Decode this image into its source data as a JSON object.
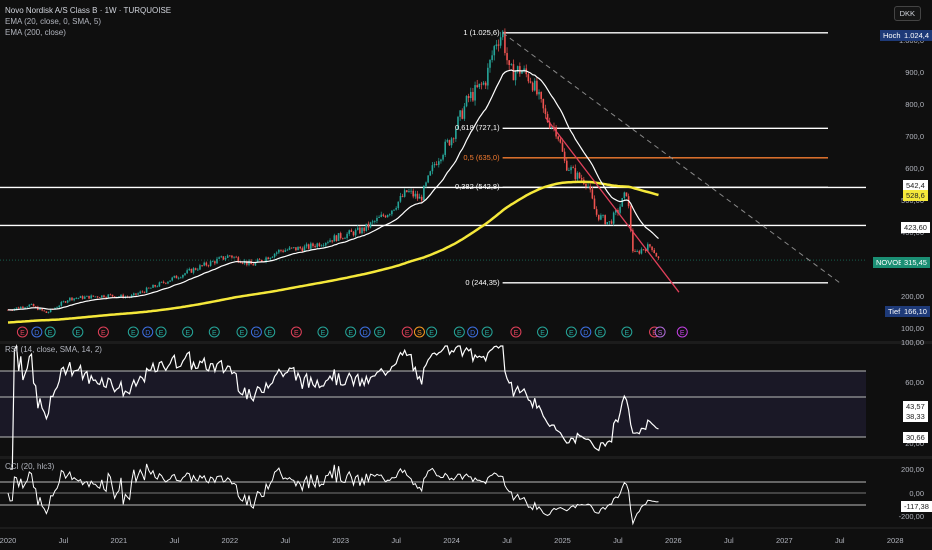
{
  "header": {
    "title": "Novo Nordisk A/S Class B · 1W · TURQUOISE",
    "indicator_1": "EMA (20, close, 0, SMA, 5)",
    "indicator_2": "EMA (200, close)",
    "currency": "DKK"
  },
  "price_axis": {
    "ticks": [
      "1.000,0",
      "900,0",
      "800,0",
      "700,0",
      "600,0",
      "500,00",
      "400,00",
      "200,00",
      "100,00"
    ],
    "tick_values": [
      1000,
      900,
      800,
      700,
      600,
      500,
      400,
      200,
      100
    ],
    "high_label": "Hoch",
    "high_value": "1.024,4",
    "low_label": "Tief",
    "low_value": "166,10",
    "symbol": "NOVOBC",
    "last_price": "315,45",
    "ema20_value": "542,4",
    "ema200_value": "528,6",
    "hline_value": "423,60"
  },
  "fibonacci": [
    {
      "label": "1 (1.025,6)",
      "price": 1025.6,
      "color": "#ffffff"
    },
    {
      "label": "0,618 (727,1)",
      "price": 727.1,
      "color": "#ffffff"
    },
    {
      "label": "0,5 (635,0)",
      "price": 635.0,
      "color": "#f57c30"
    },
    {
      "label": "0,382 (542,8)",
      "price": 542.8,
      "color": "#ffffff"
    },
    {
      "label": "0 (244,35)",
      "price": 244.35,
      "color": "#ffffff"
    }
  ],
  "rsi": {
    "label": "RSI (14, close, SMA, 14, 2)",
    "ticks": [
      "100,00",
      "60,00",
      "20,00"
    ],
    "value_1": "43,57",
    "value_2": "38,33",
    "value_3": "30,66"
  },
  "cci": {
    "label": "CCI (20, hlc3)",
    "ticks": [
      "200,00",
      "0,00",
      "-200,00"
    ],
    "value": "-117,38"
  },
  "time_axis": [
    "2020",
    "Jul",
    "2021",
    "Jul",
    "2022",
    "Jul",
    "2023",
    "Jul",
    "2024",
    "Jul",
    "2025",
    "Jul",
    "2026",
    "Jul",
    "2027",
    "Jul",
    "2028"
  ],
  "colors": {
    "up": "#26a69a",
    "down": "#ef5350",
    "ema20": "#ffffff",
    "ema200": "#f5e83a",
    "trend": "#e0405a"
  },
  "events": [
    {
      "date": 2020.13,
      "type": "E",
      "color": "#e0405a"
    },
    {
      "date": 2020.26,
      "type": "D",
      "color": "#3d6fe0"
    },
    {
      "date": 2020.38,
      "type": "E",
      "color": "#26a69a"
    },
    {
      "date": 2020.63,
      "type": "E",
      "color": "#26a69a"
    },
    {
      "date": 2020.86,
      "type": "E",
      "color": "#e0405a"
    },
    {
      "date": 2021.13,
      "type": "E",
      "color": "#26a69a"
    },
    {
      "date": 2021.26,
      "type": "D",
      "color": "#3d6fe0"
    },
    {
      "date": 2021.38,
      "type": "E",
      "color": "#26a69a"
    },
    {
      "date": 2021.62,
      "type": "E",
      "color": "#26a69a"
    },
    {
      "date": 2021.86,
      "type": "E",
      "color": "#26a69a"
    },
    {
      "date": 2022.11,
      "type": "E",
      "color": "#26a69a"
    },
    {
      "date": 2022.24,
      "type": "D",
      "color": "#3d6fe0"
    },
    {
      "date": 2022.36,
      "type": "E",
      "color": "#26a69a"
    },
    {
      "date": 2022.6,
      "type": "E",
      "color": "#e0405a"
    },
    {
      "date": 2022.84,
      "type": "E",
      "color": "#26a69a"
    },
    {
      "date": 2023.09,
      "type": "E",
      "color": "#26a69a"
    },
    {
      "date": 2023.22,
      "type": "D",
      "color": "#3d6fe0"
    },
    {
      "date": 2023.35,
      "type": "E",
      "color": "#26a69a"
    },
    {
      "date": 2023.6,
      "type": "E",
      "color": "#e0405a"
    },
    {
      "date": 2023.71,
      "type": "S",
      "color": "#f59a23"
    },
    {
      "date": 2023.82,
      "type": "E",
      "color": "#26a69a"
    },
    {
      "date": 2024.07,
      "type": "E",
      "color": "#26a69a"
    },
    {
      "date": 2024.19,
      "type": "D",
      "color": "#3d6fe0"
    },
    {
      "date": 2024.32,
      "type": "E",
      "color": "#26a69a"
    },
    {
      "date": 2024.58,
      "type": "E",
      "color": "#e0405a"
    },
    {
      "date": 2024.82,
      "type": "E",
      "color": "#26a69a"
    },
    {
      "date": 2025.08,
      "type": "E",
      "color": "#26a69a"
    },
    {
      "date": 2025.21,
      "type": "D",
      "color": "#3d6fe0"
    },
    {
      "date": 2025.34,
      "type": "E",
      "color": "#26a69a"
    },
    {
      "date": 2025.58,
      "type": "E",
      "color": "#26a69a"
    },
    {
      "date": 2025.83,
      "type": "E",
      "color": "#e0405a"
    },
    {
      "date": 2025.88,
      "type": "S",
      "color": "#b06ad8"
    },
    {
      "date": 2026.08,
      "type": "E",
      "color": "#c040e0"
    }
  ],
  "chart_data": {
    "type": "line",
    "title": "Novo Nordisk A/S Class B · 1W",
    "x_range": [
      2020.0,
      2028.2
    ],
    "y_range": [
      100,
      1100
    ],
    "price_path": [
      [
        2020.0,
        160
      ],
      [
        2020.2,
        175
      ],
      [
        2020.35,
        150
      ],
      [
        2020.55,
        195
      ],
      [
        2020.9,
        205
      ],
      [
        2021.1,
        200
      ],
      [
        2021.4,
        245
      ],
      [
        2021.7,
        290
      ],
      [
        2022.0,
        330
      ],
      [
        2022.2,
        300
      ],
      [
        2022.45,
        345
      ],
      [
        2022.7,
        355
      ],
      [
        2022.95,
        385
      ],
      [
        2023.2,
        410
      ],
      [
        2023.45,
        470
      ],
      [
        2023.6,
        530
      ],
      [
        2023.72,
        505
      ],
      [
        2023.85,
        620
      ],
      [
        2024.0,
        700
      ],
      [
        2024.15,
        820
      ],
      [
        2024.3,
        870
      ],
      [
        2024.4,
        1000
      ],
      [
        2024.46,
        1025
      ],
      [
        2024.52,
        900
      ],
      [
        2024.62,
        910
      ],
      [
        2024.72,
        880
      ],
      [
        2024.85,
        760
      ],
      [
        2024.95,
        720
      ],
      [
        2025.02,
        620
      ],
      [
        2025.12,
        580
      ],
      [
        2025.22,
        560
      ],
      [
        2025.3,
        460
      ],
      [
        2025.42,
        430
      ],
      [
        2025.5,
        470
      ],
      [
        2025.58,
        530
      ],
      [
        2025.64,
        330
      ],
      [
        2025.72,
        350
      ],
      [
        2025.8,
        360
      ],
      [
        2025.87,
        315
      ]
    ],
    "trendline": [
      [
        2024.85,
        760
      ],
      [
        2026.05,
        215
      ]
    ],
    "fib_extension": [
      [
        2024.46,
        1025.6
      ],
      [
        2027.5,
        244.35
      ]
    ]
  }
}
